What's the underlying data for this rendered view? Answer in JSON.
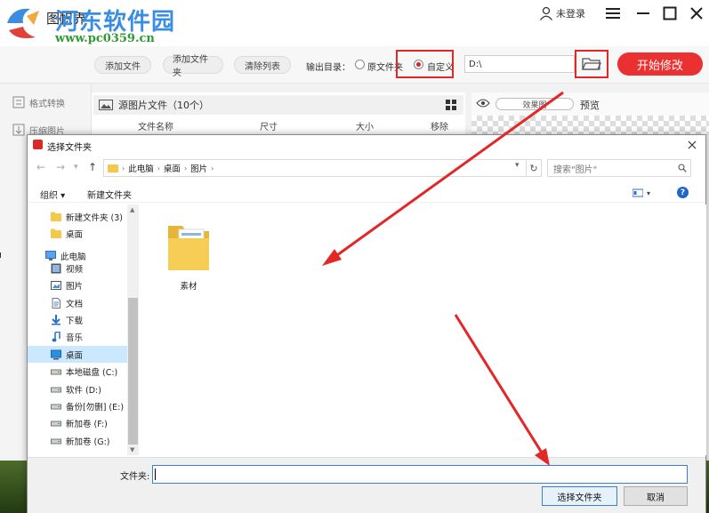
{
  "app": {
    "title": "图帜界",
    "watermark_name": "河东软件园",
    "watermark_url": "www.pc0359.cn",
    "user_label": "未登录"
  },
  "toolbar": {
    "add_file": "添加文件",
    "add_folder": "添加文件夹",
    "clear_list": "清除列表",
    "output_label": "输出目录：",
    "radio_original": "原文件夹",
    "radio_custom": "自定义",
    "output_path": "D:\\",
    "start_button": "开始修改"
  },
  "left_nav": {
    "items": [
      {
        "label": "格式转换",
        "icon": "format-convert-icon"
      },
      {
        "label": "压缩图片",
        "icon": "compress-icon"
      }
    ]
  },
  "file_list": {
    "header": "源图片文件（10个）",
    "columns": [
      "文件名称",
      "尺寸",
      "大小",
      "移除"
    ]
  },
  "preview": {
    "effect_label": "效果图",
    "preview_label": "预览"
  },
  "dialog": {
    "title": "选择文件夹",
    "breadcrumb": [
      "此电脑",
      "桌面",
      "图片"
    ],
    "search_placeholder": "搜索\"图片\"",
    "organize_label": "组织 ▾",
    "new_folder_label": "新建文件夹",
    "tree": [
      {
        "label": "新建文件夹 (3)",
        "icon": "folder-icon",
        "indent": 1
      },
      {
        "label": "桌面",
        "icon": "folder-icon",
        "indent": 1
      },
      {
        "label": "此电脑",
        "icon": "computer-icon",
        "indent": 0
      },
      {
        "label": "视频",
        "icon": "video-icon",
        "indent": 1
      },
      {
        "label": "图片",
        "icon": "picture-icon",
        "indent": 1
      },
      {
        "label": "文档",
        "icon": "document-icon",
        "indent": 1
      },
      {
        "label": "下载",
        "icon": "download-icon",
        "indent": 1
      },
      {
        "label": "音乐",
        "icon": "music-icon",
        "indent": 1
      },
      {
        "label": "桌面",
        "icon": "desktop-icon",
        "indent": 1,
        "selected": true
      },
      {
        "label": "本地磁盘 (C:)",
        "icon": "drive-icon",
        "indent": 1
      },
      {
        "label": "软件 (D:)",
        "icon": "drive-icon",
        "indent": 1
      },
      {
        "label": "备份[勿删] (E:)",
        "icon": "drive-icon",
        "indent": 1
      },
      {
        "label": "新加卷 (F:)",
        "icon": "drive-icon",
        "indent": 1
      },
      {
        "label": "新加卷 (G:)",
        "icon": "drive-icon",
        "indent": 1
      }
    ],
    "items": [
      {
        "label": "素材",
        "icon": "folder-icon"
      }
    ],
    "folder_field_label": "文件夹:",
    "folder_field_value": "",
    "select_button": "选择文件夹",
    "cancel_button": "取消"
  },
  "colors": {
    "accent_red": "#ea3030",
    "annotation_red": "#e32626",
    "selection_blue": "#cce8ff"
  }
}
